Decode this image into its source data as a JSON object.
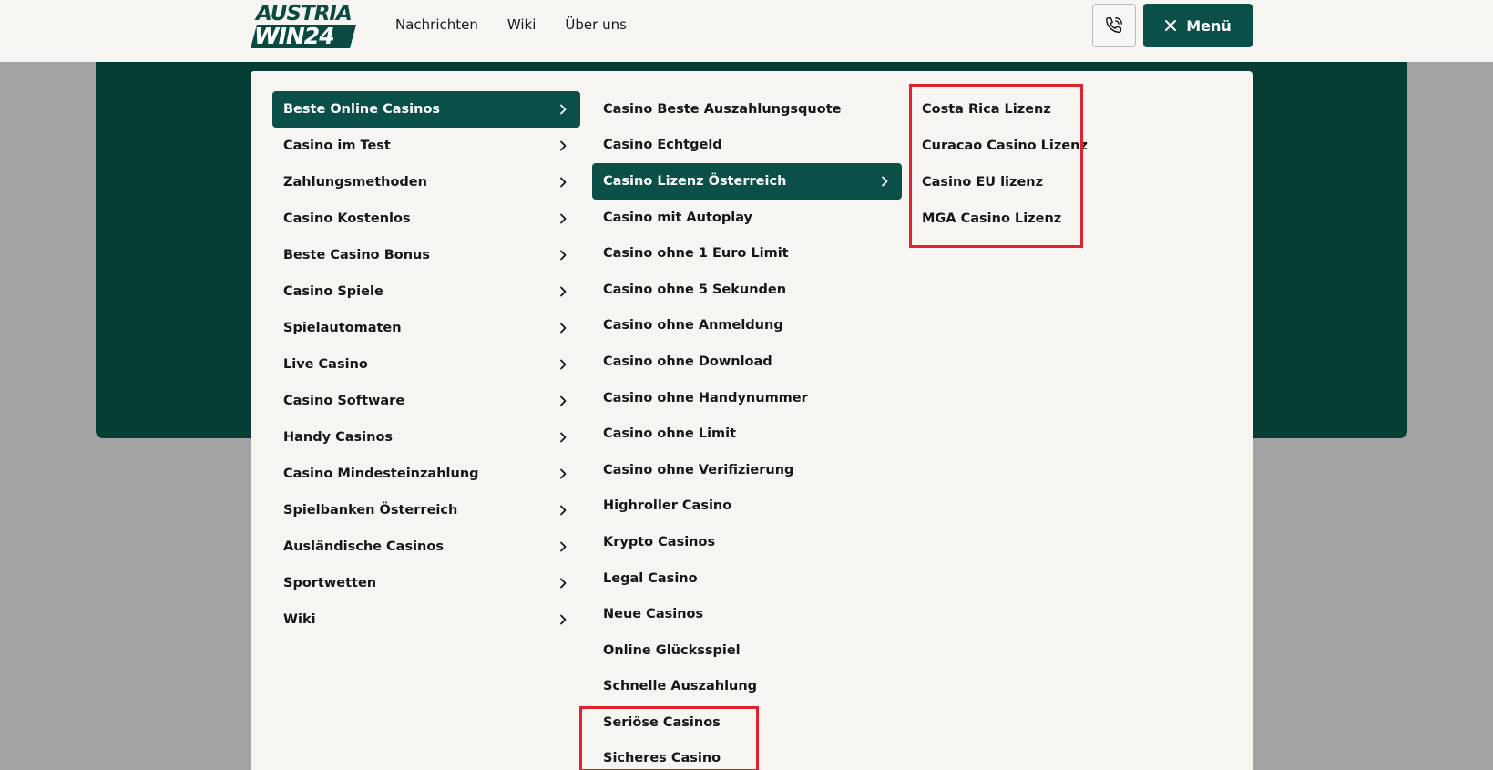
{
  "header": {
    "logo_top": "AUSTRIA",
    "logo_bottom": "WIN24",
    "nav": [
      "Nachrichten",
      "Wiki",
      "Über uns"
    ],
    "menu_label": "Menü",
    "icons": {
      "phone": "phone-icon",
      "close": "close-icon"
    }
  },
  "colors": {
    "brand": "#0b5048",
    "hero": "#063d35",
    "highlight_box": "#e0222c"
  },
  "menu": {
    "col1": [
      "Beste Online Casinos",
      "Casino im Test",
      "Zahlungsmethoden",
      "Casino Kostenlos",
      "Beste Casino Bonus",
      "Casino Spiele",
      "Spielautomaten",
      "Live Casino",
      "Casino Software",
      "Handy Casinos",
      "Casino Mindesteinzahlung",
      "Spielbanken Österreich",
      "Ausländische Casinos",
      "Sportwetten",
      "Wiki"
    ],
    "col2": [
      "Casino Beste Auszahlungsquote",
      "Casino Echtgeld",
      "Casino Lizenz Österreich",
      "Casino mit Autoplay",
      "Casino ohne 1 Euro Limit",
      "Casino ohne 5 Sekunden",
      "Casino ohne Anmeldung",
      "Casino ohne Download",
      "Casino ohne Handynummer",
      "Casino ohne Limit",
      "Casino ohne Verifizierung",
      "Highroller Casino",
      "Krypto Casinos",
      "Legal Casino",
      "Neue Casinos",
      "Online Glücksspiel",
      "Schnelle Auszahlung",
      "Seriöse Casinos",
      "Sicheres Casino"
    ],
    "col3": [
      "Costa Rica Lizenz",
      "Curacao Casino Lizenz",
      "Casino EU lizenz",
      "MGA Casino Lizenz"
    ]
  }
}
